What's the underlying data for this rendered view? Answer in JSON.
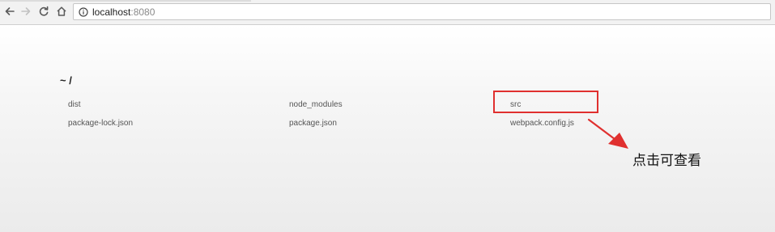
{
  "browser": {
    "url_host": "localhost",
    "url_port": ":8080",
    "icons": {
      "back": "back-arrow-icon",
      "forward": "forward-arrow-icon",
      "reload": "reload-icon",
      "home": "home-icon",
      "info": "info-icon"
    }
  },
  "directory": {
    "title": "~ /",
    "files": [
      "dist",
      "node_modules",
      "src",
      "package-lock.json",
      "package.json",
      "webpack.config.js"
    ]
  },
  "annotation": {
    "text": "点击可查看",
    "color": "#e0302f"
  }
}
